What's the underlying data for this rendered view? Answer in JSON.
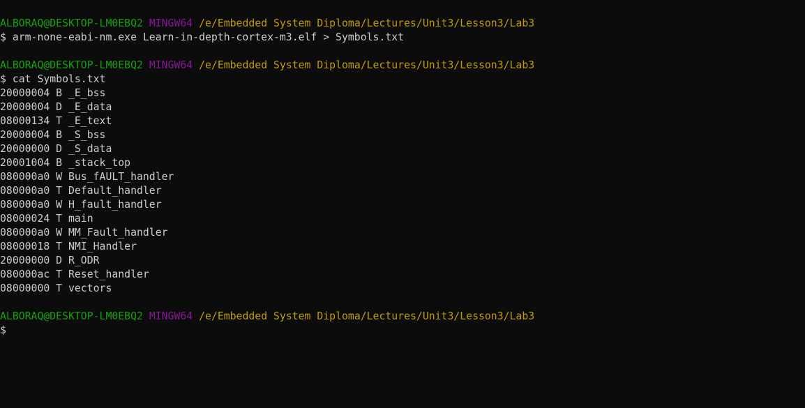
{
  "colors": {
    "background": "#0c0c0c",
    "text": "#cccccc",
    "user_host": "#13a10e",
    "mingw": "#881798",
    "path": "#c19c00"
  },
  "prompts": [
    {
      "user_host": "ALBORAQ@DESKTOP-LM0EBQ2",
      "system": "MINGW64",
      "path": "/e/Embedded System Diploma/Lectures/Unit3/Lesson3/Lab3",
      "command": "$ arm-none-eabi-nm.exe Learn-in-depth-cortex-m3.elf > Symbols.txt"
    },
    {
      "user_host": "ALBORAQ@DESKTOP-LM0EBQ2",
      "system": "MINGW64",
      "path": "/e/Embedded System Diploma/Lectures/Unit3/Lesson3/Lab3",
      "command": "$ cat Symbols.txt"
    },
    {
      "user_host": "ALBORAQ@DESKTOP-LM0EBQ2",
      "system": "MINGW64",
      "path": "/e/Embedded System Diploma/Lectures/Unit3/Lesson3/Lab3",
      "command": "$"
    }
  ],
  "symbols": [
    "20000004 B _E_bss",
    "20000004 D _E_data",
    "08000134 T _E_text",
    "20000004 B _S_bss",
    "20000000 D _S_data",
    "20001004 B _stack_top",
    "080000a0 W Bus_fAULT_handler",
    "080000a0 T Default_handler",
    "080000a0 W H_fault_handler",
    "08000024 T main",
    "080000a0 W MM_Fault_handler",
    "08000018 T NMI_Handler",
    "20000000 D R_ODR",
    "080000ac T Reset_handler",
    "08000000 T vectors"
  ]
}
